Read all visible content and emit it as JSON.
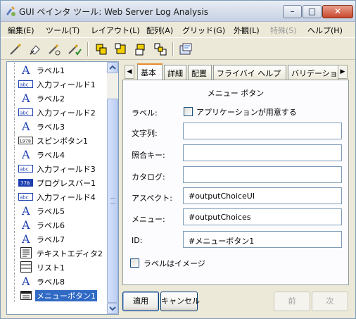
{
  "window": {
    "title": "GUI ペインタ ツール: Web Server Log Analysis",
    "controls": {
      "minimize": "–",
      "maximize": "□",
      "close": "✕"
    }
  },
  "menubar": {
    "items": [
      {
        "label": "編集(E)",
        "enabled": true
      },
      {
        "label": "ツール(T)",
        "enabled": true
      },
      {
        "label": "レイアウト(L)",
        "enabled": true
      },
      {
        "label": "配列(A)",
        "enabled": true
      },
      {
        "label": "グリッド(G)",
        "enabled": true
      },
      {
        "label": "外観(L)",
        "enabled": true
      },
      {
        "label": "特殊(S)",
        "enabled": false
      },
      {
        "label": "ヘルプ(H)",
        "enabled": true
      }
    ]
  },
  "toolbar": {
    "icons": [
      "wand-icon",
      "eraser-icon",
      "wand-multi-icon",
      "wand-check-icon",
      "align-top-left-icon",
      "align-bottom-right-icon",
      "align-center-icon",
      "align-distribute-icon",
      "preview-icon"
    ]
  },
  "tree": {
    "items": [
      {
        "label": "ラベル1",
        "type": "label"
      },
      {
        "label": "入力フィールド1",
        "type": "input"
      },
      {
        "label": "ラベル2",
        "type": "label"
      },
      {
        "label": "入力フィールド2",
        "type": "input"
      },
      {
        "label": "ラベル3",
        "type": "label"
      },
      {
        "label": "スピンボタン1",
        "type": "spin"
      },
      {
        "label": "ラベル4",
        "type": "label"
      },
      {
        "label": "入力フィールド3",
        "type": "input"
      },
      {
        "label": "プログレスバー1",
        "type": "progress"
      },
      {
        "label": "入力フィールド4",
        "type": "input"
      },
      {
        "label": "ラベル5",
        "type": "label"
      },
      {
        "label": "ラベル6",
        "type": "label"
      },
      {
        "label": "ラベル7",
        "type": "label"
      },
      {
        "label": "テキストエディタ2",
        "type": "texteditor"
      },
      {
        "label": "リスト1",
        "type": "list"
      },
      {
        "label": "ラベル8",
        "type": "label"
      },
      {
        "label": "メニューボタン1",
        "type": "menubutton",
        "selected": true
      }
    ],
    "icon_text": {
      "input": "abc",
      "spin": "1978",
      "progress": "778"
    }
  },
  "tabs": {
    "items": [
      "基本",
      "詳細",
      "配置",
      "フライバイ ヘルプ",
      "バリデーショ"
    ],
    "active": 0,
    "prev_arrow": "◀",
    "next_arrow": "▶"
  },
  "panel": {
    "title": "メニュー ボタン",
    "label_caption": "ラベル:",
    "app_provided_label": "アプリケーションが用意する",
    "app_provided_checked": false,
    "fields": [
      {
        "caption": "文字列:",
        "value": ""
      },
      {
        "caption": "照合キー:",
        "value": ""
      },
      {
        "caption": "カタログ:",
        "value": ""
      },
      {
        "caption": "アスペクト:",
        "value": "#outputChoiceUI"
      },
      {
        "caption": "メニュー:",
        "value": "#outputChoices"
      },
      {
        "caption": "ID:",
        "value": "#メニューボタン1"
      }
    ],
    "image_label": "ラベルはイメージ",
    "image_label_checked": false
  },
  "buttons": {
    "apply": "適用",
    "cancel": "キャンセル",
    "prev": "前",
    "next": "次"
  }
}
